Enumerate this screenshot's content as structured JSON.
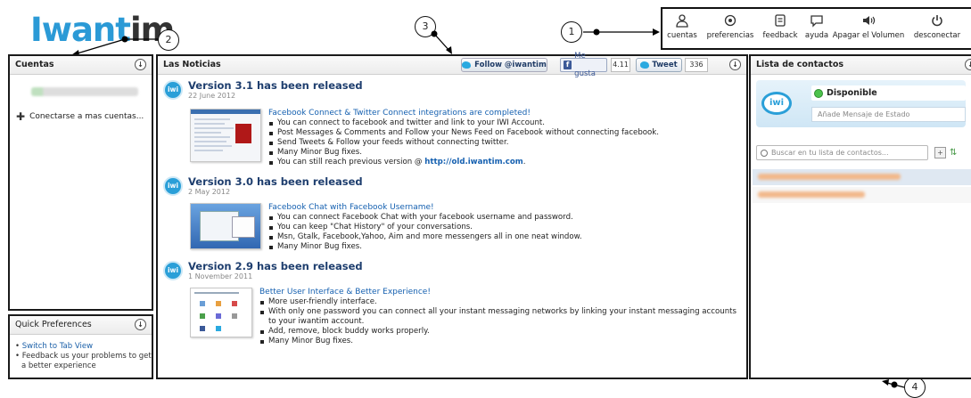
{
  "logo": {
    "part1": "Iwant",
    "part2": "im"
  },
  "callouts": [
    "1",
    "2",
    "3",
    "4"
  ],
  "toolbar": {
    "items": [
      {
        "label": "cuentas",
        "icon": "accounts-icon"
      },
      {
        "label": "preferencias",
        "icon": "preferences-icon"
      },
      {
        "label": "feedback",
        "icon": "feedback-icon"
      },
      {
        "label": "ayuda",
        "icon": "help-icon"
      },
      {
        "label": "Apagar el Volumen",
        "icon": "volume-icon"
      },
      {
        "label": "desconectar",
        "icon": "power-icon"
      }
    ]
  },
  "cuentas": {
    "title": "Cuentas",
    "connect_more": "Conectarse a mas cuentas..."
  },
  "quick": {
    "title": "Quick Preferences",
    "items": [
      "Switch to Tab View",
      "Feedback us your problems to get a better experience"
    ]
  },
  "news": {
    "title": "Las Noticias",
    "follow_label": "Follow @iwantim",
    "like_label": "Me gusta",
    "like_count": "4.11",
    "tweet_label": "Tweet",
    "tweet_count": "336",
    "releases": [
      {
        "title": "Version 3.1 has been released",
        "date": "22 June 2012",
        "feature_title": "Facebook Connect & Twitter Connect integrations are completed!",
        "bullets": [
          "You can connect to facebook and twitter and link to your IWI Account.",
          "Post Messages & Comments and Follow your News Feed on Facebook without connecting facebook.",
          "Send Tweets & Follow your feeds without connecting twitter.",
          "Many Minor Bug fixes."
        ],
        "last_bullet_prefix": "You can still reach previous version @ ",
        "last_bullet_link": "http://old.iwantim.com",
        "last_bullet_suffix": "."
      },
      {
        "title": "Version 3.0 has been released",
        "date": "2 May 2012",
        "feature_title": "Facebook Chat with Facebook Username!",
        "bullets": [
          "You can connect Facebook Chat with your facebook username and password.",
          "You can keep \"Chat History\" of your conversations.",
          "Msn, Gtalk, Facebook,Yahoo, Aim and more messengers all in one neat window.",
          "Many Minor Bug fixes."
        ]
      },
      {
        "title": "Version 2.9 has been released",
        "date": "1 November 2011",
        "feature_title": "Better User Interface & Better Experience!",
        "bullets": [
          "More user-friendly interface.",
          "With only one password you can connect all your instant messaging networks by linking your instant messaging accounts to your iwantim account.",
          "Add, remove, block buddy works properly.",
          "Many Minor Bug fixes."
        ]
      }
    ]
  },
  "contacts": {
    "title": "Lista de contactos",
    "avatar_text": "iwi",
    "status": "Disponible",
    "status_placeholder": "Añade Mensaje de Estado",
    "search_placeholder": "Buscar en tu lista de contactos..."
  },
  "colors": {
    "brand_blue": "#2b9ad6",
    "link_blue": "#1560b0",
    "title_navy": "#1e3e6e",
    "available_green": "#4cc24c"
  }
}
